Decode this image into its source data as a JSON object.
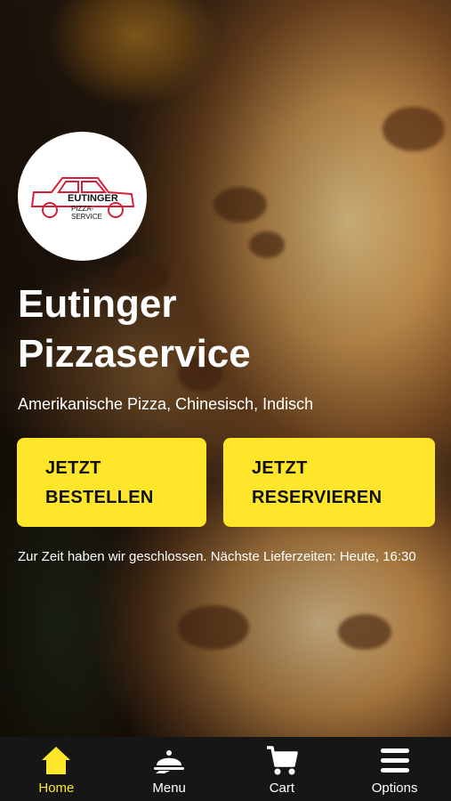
{
  "restaurant": {
    "logo_line1": "EUTINGER",
    "logo_line2": "PIZZA-",
    "logo_line3": "SERVICE",
    "title_line1": "Eutinger",
    "title_line2": "Pizzaservice",
    "cuisines": "Amerikanische Pizza, Chinesisch, Indisch"
  },
  "actions": {
    "order_line1": "JETZT",
    "order_line2": "BESTELLEN",
    "reserve_line1": "JETZT",
    "reserve_line2": "RESERVIEREN"
  },
  "notice": "Zur Zeit haben wir geschlossen. Nächste Lieferzeiten: Heute, 16:30",
  "tabs": [
    {
      "label": "Home",
      "icon": "home-icon",
      "active": true
    },
    {
      "label": "Menu",
      "icon": "serving-dish-icon",
      "active": false
    },
    {
      "label": "Cart",
      "icon": "cart-icon",
      "active": false
    },
    {
      "label": "Options",
      "icon": "menu-lines-icon",
      "active": false
    }
  ],
  "colors": {
    "accent": "#ffe62b",
    "tabbar_bg": "#161616",
    "logo_red": "#d6203a"
  }
}
